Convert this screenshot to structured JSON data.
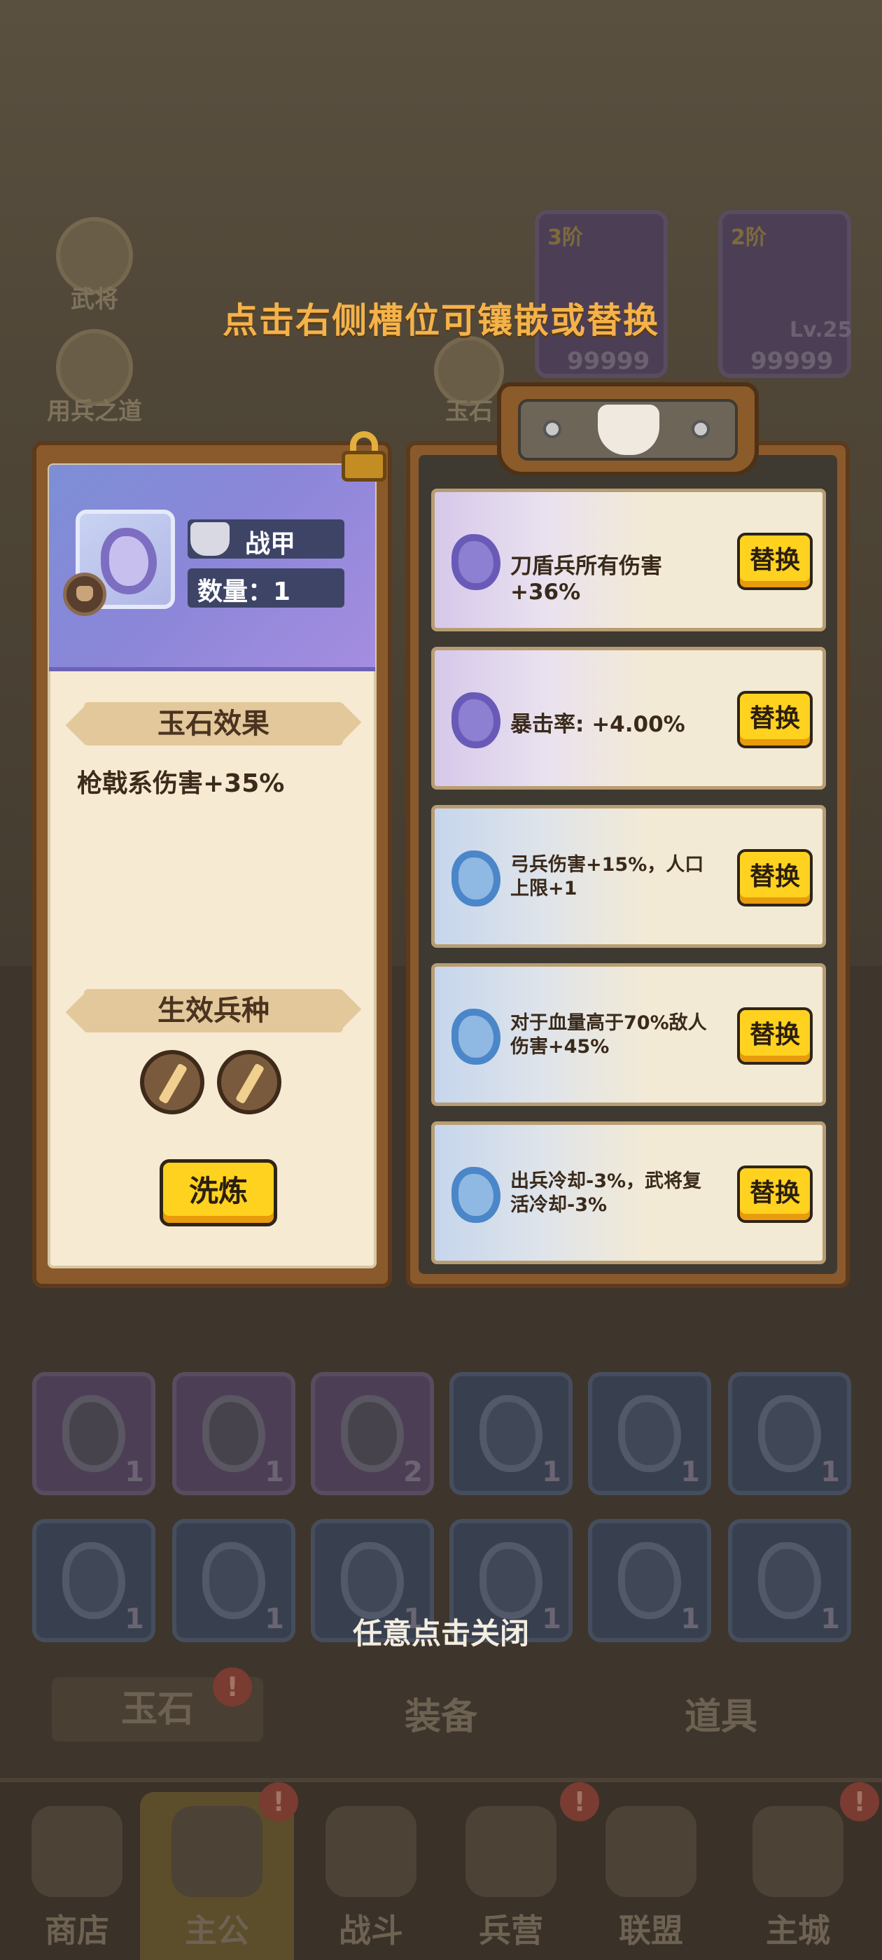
{
  "background": {
    "top_labels": [
      "武将",
      "用兵之道",
      "玉石"
    ],
    "armor_cards": [
      {
        "tier": "3阶",
        "value": "99999"
      },
      {
        "tier": "2阶",
        "level": "Lv.25",
        "value": "99999"
      }
    ],
    "tabs": [
      "玉石",
      "装备",
      "道具"
    ],
    "nav": [
      "商店",
      "主公",
      "战斗",
      "兵营",
      "联盟",
      "主城"
    ],
    "grid_counts": [
      "1",
      "1",
      "2",
      "1",
      "1",
      "1",
      "1",
      "1",
      "1",
      "1",
      "1",
      "1"
    ]
  },
  "overlay": {
    "hint_top": "点击右侧槽位可镶嵌或替换",
    "hint_close": "任意点击关闭"
  },
  "left_panel": {
    "slot_name": "战甲",
    "quantity": "数量：1",
    "effect_header": "玉石效果",
    "effect_text": "枪戟系伤害+35%",
    "troop_header": "生效兵种",
    "wash_button": "洗炼"
  },
  "right_panel": {
    "slots": [
      {
        "rarity": "purple",
        "text": "刀盾兵所有伤害+36%",
        "button": "替换"
      },
      {
        "rarity": "purple",
        "text": "暴击率: +4.00%",
        "button": "替换"
      },
      {
        "rarity": "blue",
        "text": "弓兵伤害+15%，人口上限+1",
        "button": "替换"
      },
      {
        "rarity": "blue",
        "text": "对于血量高于70%敌人伤害+45%",
        "button": "替换"
      },
      {
        "rarity": "blue",
        "text": "出兵冷却-3%，武将复活冷却-3%",
        "button": "替换"
      }
    ]
  },
  "colors": {
    "accent_yellow": "#ffd21f",
    "hint_orange": "#f4b24a",
    "purple_jade": "#6a5ab8",
    "blue_jade": "#4b86c9"
  }
}
